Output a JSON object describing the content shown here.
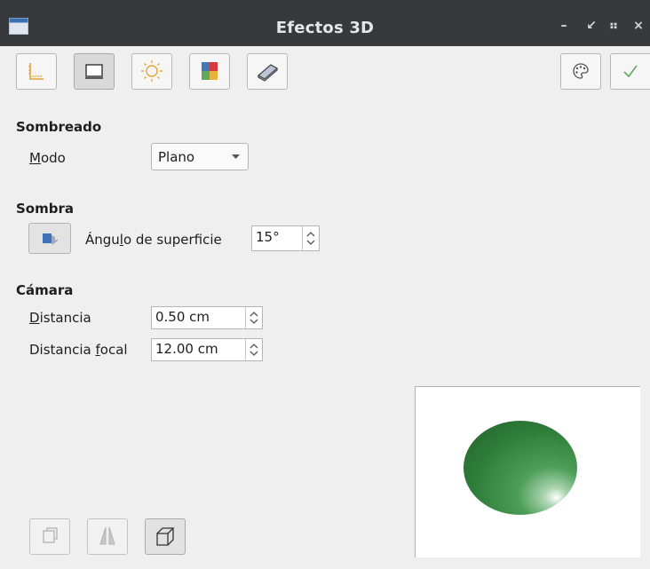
{
  "window": {
    "title": "Efectos 3D",
    "icon": "window-icon"
  },
  "window_controls": {
    "minimize": "–",
    "restore": "↙",
    "maximize": "⠶",
    "close": "×"
  },
  "toolbar": {
    "buttons": [
      {
        "name": "geometry",
        "icon": "axes-icon"
      },
      {
        "name": "shading",
        "icon": "rectangle-icon",
        "active": true
      },
      {
        "name": "illumination",
        "icon": "sun-icon"
      },
      {
        "name": "textures",
        "icon": "color-squares-icon"
      },
      {
        "name": "material",
        "icon": "material-icon"
      }
    ],
    "right_buttons": [
      {
        "name": "assign",
        "icon": "palette-icon"
      },
      {
        "name": "apply",
        "icon": "checkmark-icon"
      }
    ]
  },
  "shading": {
    "heading": "Sombreado",
    "mode_label_underlined": "M",
    "mode_label_rest": "odo",
    "mode_value": "Plano"
  },
  "shadow": {
    "heading": "Sombra",
    "angle_label_pre": "Ángu",
    "angle_label_u": "l",
    "angle_label_post": "o de superficie",
    "angle_value": "15°"
  },
  "camera": {
    "heading": "Cámara",
    "distance_label_u": "D",
    "distance_label_rest": "istancia",
    "distance_value": "0.50 cm",
    "focal_label_pre": "Distancia ",
    "focal_label_u": "f",
    "focal_label_post": "ocal",
    "focal_value": "12.00 cm"
  },
  "bottom_buttons": [
    {
      "name": "convert-3d",
      "icon": "convert-3d-icon"
    },
    {
      "name": "perspective",
      "icon": "perspective-icon"
    },
    {
      "name": "cube",
      "icon": "cube-icon",
      "active": true
    }
  ],
  "colors": {
    "titlebar": "#37393c",
    "sphere": "#3a8a45",
    "background": "#efefef"
  }
}
